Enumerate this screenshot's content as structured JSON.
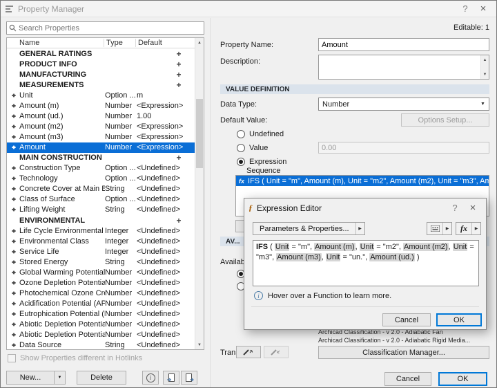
{
  "colors": {
    "selection_blue": "#0a6ed6",
    "accent": "#0078d7",
    "section_header_bg": "#dbe3ec"
  },
  "icons": {
    "help": "?",
    "close": "×",
    "dropdown": "▼",
    "submenu": "▶",
    "plus": "+",
    "info": "i",
    "fx": "fx",
    "scroll_up": "▲",
    "scroll_down": "▼",
    "function": "ƒ"
  },
  "window": {
    "title": "Property Manager"
  },
  "left_panel": {
    "search_placeholder": "Search Properties",
    "table": {
      "columns": [
        "Name",
        "Type",
        "Default"
      ],
      "rows": [
        {
          "kind": "category",
          "name": "GENERAL RATINGS",
          "expanded": false
        },
        {
          "kind": "category",
          "name": "PRODUCT INFO",
          "expanded": false
        },
        {
          "kind": "category",
          "name": "MANUFACTURING",
          "expanded": false
        },
        {
          "kind": "category",
          "name": "MEASUREMENTS",
          "expanded": true
        },
        {
          "kind": "property",
          "name": "Unit",
          "type": "Option ...",
          "default": "m"
        },
        {
          "kind": "property",
          "name": "Amount (m)",
          "type": "Number",
          "default": "<Expression>"
        },
        {
          "kind": "property",
          "name": "Amount (ud.)",
          "type": "Number",
          "default": "1.00"
        },
        {
          "kind": "property",
          "name": "Amount (m2)",
          "type": "Number",
          "default": "<Expression>"
        },
        {
          "kind": "property",
          "name": "Amount (m3)",
          "type": "Number",
          "default": "<Expression>"
        },
        {
          "kind": "property",
          "name": "Amount",
          "type": "Number",
          "default": "<Expression>",
          "selected": true
        },
        {
          "kind": "category",
          "name": "MAIN CONSTRUCTION",
          "expanded": true
        },
        {
          "kind": "property",
          "name": "Construction Type",
          "type": "Option ...",
          "default": "<Undefined>"
        },
        {
          "kind": "property",
          "name": "Technology",
          "type": "Option ...",
          "default": "<Undefined>"
        },
        {
          "kind": "property",
          "name": "Concrete Cover at Main Bars",
          "type": "String",
          "default": "<Undefined>"
        },
        {
          "kind": "property",
          "name": "Class of Surface",
          "type": "Option ...",
          "default": "<Undefined>"
        },
        {
          "kind": "property",
          "name": "Lifting Weight",
          "type": "String",
          "default": "<Undefined>"
        },
        {
          "kind": "category",
          "name": "ENVIRONMENTAL",
          "expanded": true
        },
        {
          "kind": "property",
          "name": "Life Cycle Environmental",
          "type": "Integer",
          "default": "<Undefined>"
        },
        {
          "kind": "property",
          "name": "Environmental Class",
          "type": "Integer",
          "default": "<Undefined>"
        },
        {
          "kind": "property",
          "name": "Service Life",
          "type": "Integer",
          "default": "<Undefined>"
        },
        {
          "kind": "property",
          "name": "Stored Energy",
          "type": "String",
          "default": "<Undefined>"
        },
        {
          "kind": "property",
          "name": "Global Warming Potential (G...",
          "type": "Number",
          "default": "<Undefined>"
        },
        {
          "kind": "property",
          "name": "Ozone Depletion Potential (...",
          "type": "Number",
          "default": "<Undefined>"
        },
        {
          "kind": "property",
          "name": "Photochemical Ozone Creati...",
          "type": "Number",
          "default": "<Undefined>"
        },
        {
          "kind": "property",
          "name": "Acidification Potential (AP)",
          "type": "Number",
          "default": "<Undefined>"
        },
        {
          "kind": "property",
          "name": "Eutrophication Potential (EP)",
          "type": "Number",
          "default": "<Undefined>"
        },
        {
          "kind": "property",
          "name": "Abiotic Depletion Potential (f...",
          "type": "Number",
          "default": "<Undefined>"
        },
        {
          "kind": "property",
          "name": "Abiotic Depletion Potential (f...",
          "type": "Number",
          "default": "<Undefined>"
        },
        {
          "kind": "property",
          "name": "Data Source",
          "type": "String",
          "default": "<Undefined>"
        }
      ]
    },
    "hotlinks_label": "Show Properties different in Hotlinks",
    "new_button": "New...",
    "delete_button": "Delete"
  },
  "right_panel": {
    "editable": "Editable: 1",
    "property_name_label": "Property Name:",
    "property_name_value": "Amount",
    "description_label": "Description:",
    "value_definition_header": "VALUE DEFINITION",
    "data_type_label": "Data Type:",
    "data_type_value": "Number",
    "default_value_label": "Default Value:",
    "options_setup_button": "Options Setup...",
    "radio_undefined": "Undefined",
    "radio_value": "Value",
    "value_field": "0.00",
    "radio_expression": "Expression",
    "sequence_label": "Sequence",
    "sequence_expression": "IFS ( Unit = \"m\", Amount (m), Unit = \"m2\", Amount (m2), Unit = \"m3\", Amount (m3), U...",
    "availability_header": "AV...",
    "availability_label": "Availab...",
    "transfer_label": "Transfer:",
    "classification_lines": [
      "Archicad Classification - v 2.0 - Adiabatic Fan",
      "Archicad Classification - v 2.0 - Adiabatic Rigid Media..."
    ],
    "classification_manager_button": "Classification Manager...",
    "cancel_button": "Cancel",
    "ok_button": "OK"
  },
  "expression_editor": {
    "title": "Expression Editor",
    "parameters_button": "Parameters & Properties...",
    "hint": "Hover over a Function to learn more.",
    "cancel_button": "Cancel",
    "ok_button": "OK",
    "tokens": [
      {
        "text": "IFS",
        "bold": true
      },
      {
        "text": " ( "
      },
      {
        "text": "Unit",
        "chip": true
      },
      {
        "text": " = \"m\", "
      },
      {
        "text": "Amount (m)",
        "chip": true
      },
      {
        "text": ", "
      },
      {
        "text": "Unit",
        "chip": true
      },
      {
        "text": " = \"m2\", "
      },
      {
        "text": "Amount (m2)",
        "chip": true
      },
      {
        "text": ", "
      },
      {
        "text": "Unit",
        "chip": true
      },
      {
        "text": " = \"m3\", "
      },
      {
        "text": "Amount (m3)",
        "chip": true
      },
      {
        "text": ", "
      },
      {
        "text": "Unit",
        "chip": true
      },
      {
        "text": " = \"un.\", "
      },
      {
        "text": "Amount (ud.)",
        "chip": true
      },
      {
        "text": " )"
      }
    ]
  }
}
